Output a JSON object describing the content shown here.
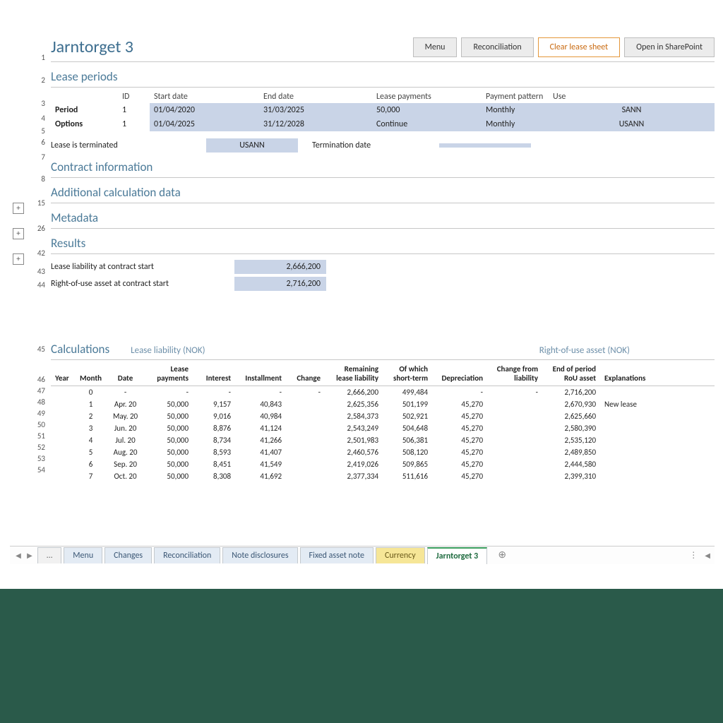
{
  "title": "Jarntorget 3",
  "buttons": {
    "menu": "Menu",
    "reconciliation": "Reconciliation",
    "clear": "Clear lease sheet",
    "sharepoint": "Open in SharePoint"
  },
  "sections": {
    "lease_periods": "Lease periods",
    "contract_info": "Contract information",
    "additional": "Additional calculation data",
    "metadata": "Metadata",
    "results": "Results",
    "calculations": "Calculations"
  },
  "periods": {
    "hdr_id": "ID",
    "hdr_start": "Start date",
    "hdr_end": "End date",
    "hdr_payments": "Lease payments",
    "hdr_pattern": "Payment pattern",
    "hdr_use": "Use",
    "row_period_lbl": "Period",
    "row_options_lbl": "Options",
    "period": {
      "id": "1",
      "start": "01/04/2020",
      "end": "31/03/2025",
      "pay": "50,000",
      "pattern": "Monthly",
      "use": "SANN"
    },
    "options": {
      "id": "1",
      "start": "01/04/2025",
      "end": "31/12/2028",
      "pay": "Continue",
      "pattern": "Monthly",
      "use": "USANN"
    }
  },
  "termination": {
    "lbl": "Lease is terminated",
    "val": "USANN",
    "date_lbl": "Termination date",
    "date_val": ""
  },
  "results": {
    "liab_lbl": "Lease liability at contract start",
    "liab_val": "2,666,200",
    "rou_lbl": "Right-of-use asset at contract start",
    "rou_val": "2,716,200"
  },
  "calc": {
    "sub_liab": "Lease liability (NOK)",
    "sub_rou": "Right-of-use asset (NOK)",
    "h_year": "Year",
    "h_month": "Month",
    "h_date": "Date",
    "h_pay": "Lease payments",
    "h_int": "Interest",
    "h_inst": "Installment",
    "h_chg": "Change",
    "h_rem": "Remaining lease liability",
    "h_st": "Of which short-term",
    "h_dep": "Depreciation",
    "h_chgliab": "Change from liability",
    "h_eop": "End of period RoU asset",
    "h_expl": "Explanations",
    "rows": [
      {
        "yr": "",
        "mo": "0",
        "dt": "-",
        "pay": "-",
        "int": "-",
        "inst": "-",
        "chg": "-",
        "rem": "2,666,200",
        "st": "499,484",
        "dep": "-",
        "cl": "-",
        "eop": "2,716,200",
        "ex": ""
      },
      {
        "yr": "",
        "mo": "1",
        "dt": "Apr. 20",
        "pay": "50,000",
        "int": "9,157",
        "inst": "40,843",
        "chg": "",
        "rem": "2,625,356",
        "st": "501,199",
        "dep": "45,270",
        "cl": "",
        "eop": "2,670,930",
        "ex": "New lease"
      },
      {
        "yr": "",
        "mo": "2",
        "dt": "May. 20",
        "pay": "50,000",
        "int": "9,016",
        "inst": "40,984",
        "chg": "",
        "rem": "2,584,373",
        "st": "502,921",
        "dep": "45,270",
        "cl": "",
        "eop": "2,625,660",
        "ex": ""
      },
      {
        "yr": "",
        "mo": "3",
        "dt": "Jun. 20",
        "pay": "50,000",
        "int": "8,876",
        "inst": "41,124",
        "chg": "",
        "rem": "2,543,249",
        "st": "504,648",
        "dep": "45,270",
        "cl": "",
        "eop": "2,580,390",
        "ex": ""
      },
      {
        "yr": "",
        "mo": "4",
        "dt": "Jul. 20",
        "pay": "50,000",
        "int": "8,734",
        "inst": "41,266",
        "chg": "",
        "rem": "2,501,983",
        "st": "506,381",
        "dep": "45,270",
        "cl": "",
        "eop": "2,535,120",
        "ex": ""
      },
      {
        "yr": "",
        "mo": "5",
        "dt": "Aug. 20",
        "pay": "50,000",
        "int": "8,593",
        "inst": "41,407",
        "chg": "",
        "rem": "2,460,576",
        "st": "508,120",
        "dep": "45,270",
        "cl": "",
        "eop": "2,489,850",
        "ex": ""
      },
      {
        "yr": "",
        "mo": "6",
        "dt": "Sep. 20",
        "pay": "50,000",
        "int": "8,451",
        "inst": "41,549",
        "chg": "",
        "rem": "2,419,026",
        "st": "509,865",
        "dep": "45,270",
        "cl": "",
        "eop": "2,444,580",
        "ex": ""
      },
      {
        "yr": "",
        "mo": "7",
        "dt": "Oct. 20",
        "pay": "50,000",
        "int": "8,308",
        "inst": "41,692",
        "chg": "",
        "rem": "2,377,334",
        "st": "511,616",
        "dep": "45,270",
        "cl": "",
        "eop": "2,399,310",
        "ex": ""
      }
    ]
  },
  "rownums": {
    "r1": "1",
    "r2": "2",
    "r3": "3",
    "r4": "4",
    "r5": "5",
    "r6": "6",
    "r7": "7",
    "r8": "8",
    "r15": "15",
    "r26": "26",
    "r42": "42",
    "r43": "43",
    "r44": "44",
    "r45": "45",
    "r46": "46",
    "r47": "47",
    "r48": "48",
    "r49": "49",
    "r50": "50",
    "r51": "51",
    "r52": "52",
    "r53": "53",
    "r54": "54"
  },
  "tabs": {
    "ellipsis": "…",
    "menu": "Menu",
    "changes": "Changes",
    "reconc": "Reconciliation",
    "note": "Note disclosures",
    "fixed": "Fixed asset note",
    "currency": "Currency",
    "active": "Jarntorget 3"
  }
}
